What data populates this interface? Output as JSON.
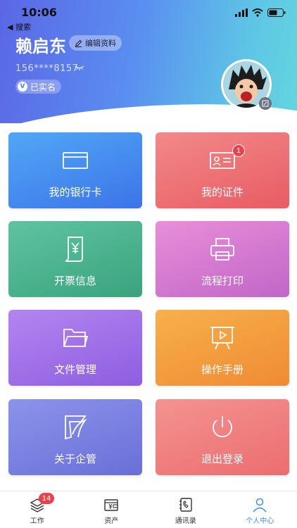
{
  "status_bar": {
    "time": "10:06",
    "back_label": "◀ 搜索"
  },
  "profile": {
    "name": "赖启东",
    "edit_label": "编辑资料",
    "phone": "156****8157",
    "verified_label": "已实名",
    "verified_mark": "V"
  },
  "cards": [
    {
      "label": "我的银行卡",
      "icon": "bank-card-icon"
    },
    {
      "label": "我的证件",
      "icon": "id-card-icon",
      "badge": "1"
    },
    {
      "label": "开票信息",
      "icon": "invoice-icon"
    },
    {
      "label": "流程打印",
      "icon": "printer-icon"
    },
    {
      "label": "文件管理",
      "icon": "folder-icon"
    },
    {
      "label": "操作手册",
      "icon": "presentation-icon"
    },
    {
      "label": "关于企管",
      "icon": "company-logo-icon"
    },
    {
      "label": "退出登录",
      "icon": "power-icon"
    }
  ],
  "tabs": [
    {
      "label": "工作",
      "icon": "layers-icon",
      "badge": "14"
    },
    {
      "label": "资产",
      "icon": "wallet-icon"
    },
    {
      "label": "通讯录",
      "icon": "contacts-icon"
    },
    {
      "label": "个人中心",
      "icon": "person-icon",
      "active": true
    }
  ],
  "colors": {
    "accent": "#3a8ef0",
    "badge": "#e8434a"
  }
}
